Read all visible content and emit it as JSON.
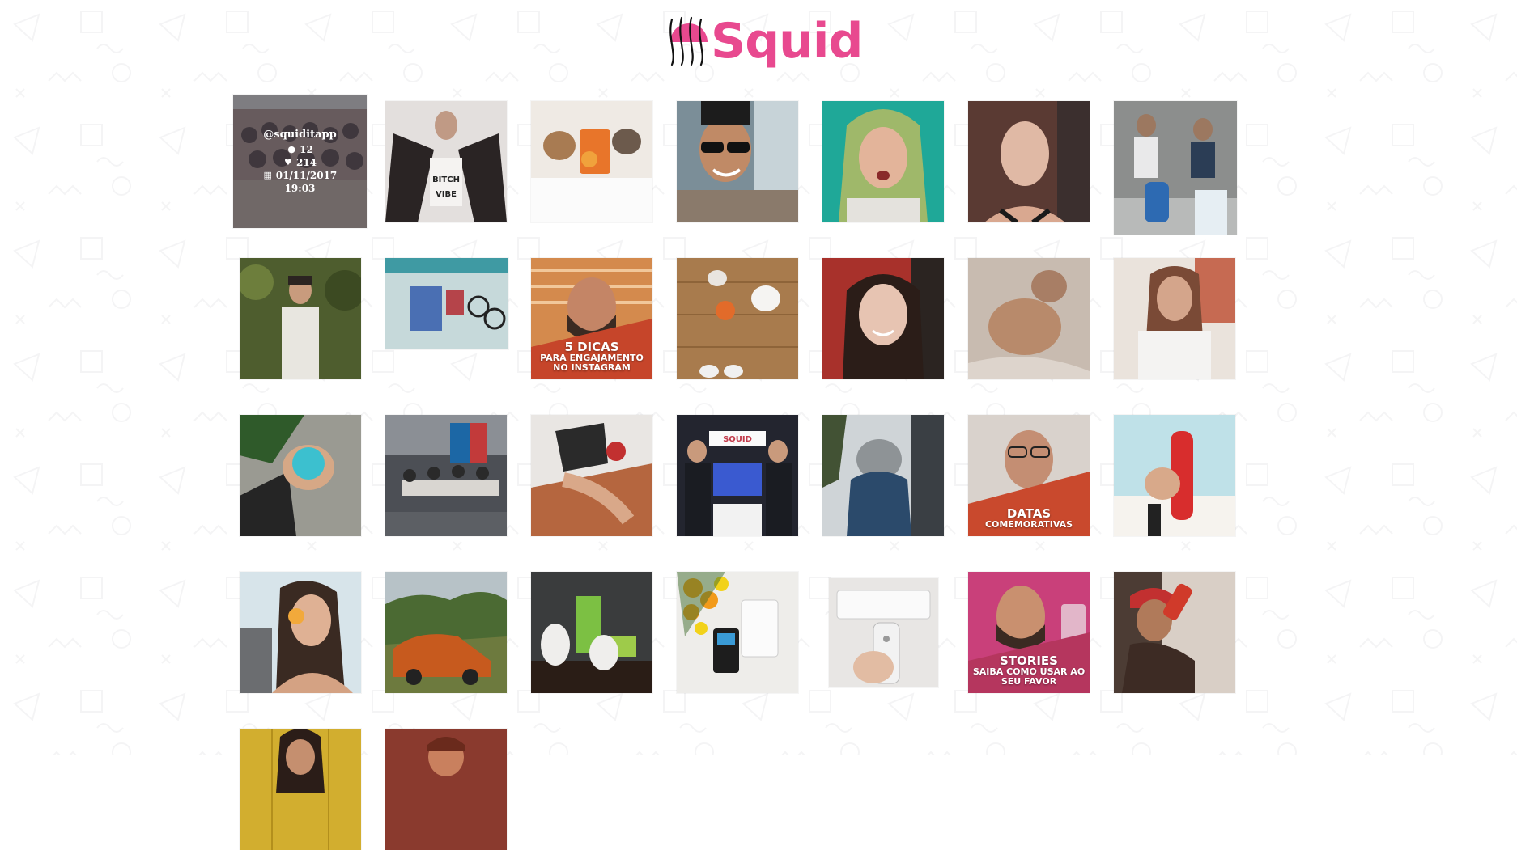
{
  "brand": {
    "name": "Squid",
    "accent": "#e8498f"
  },
  "hover_card": {
    "username": "@squiditapp",
    "comments": "12",
    "likes": "214",
    "date": "01/11/2017",
    "time": "19:03"
  },
  "tiles": [
    {
      "id": "photo-group-office",
      "tone": "#8a7f82",
      "caption": null
    },
    {
      "id": "photo-woman-bodysuit",
      "tone": "#d9d4d2",
      "caption": null
    },
    {
      "id": "photo-dogs-food",
      "tone": "#c9c1b4",
      "caption": null
    },
    {
      "id": "photo-man-sunglasses",
      "tone": "#9aa6ad",
      "caption": null
    },
    {
      "id": "photo-woman-green",
      "tone": "#3fa39a",
      "caption": null
    },
    {
      "id": "photo-woman-selfie",
      "tone": "#6b4b43",
      "caption": null
    },
    {
      "id": "photo-two-men-cleaning",
      "tone": "#8e8f8f",
      "caption": null
    },
    {
      "id": "photo-man-plants",
      "tone": "#4d5b31",
      "caption": null
    },
    {
      "id": "photo-notebook-flatlay",
      "tone": "#8fb2b6",
      "caption": null
    },
    {
      "id": "photo-man-5-dicas",
      "tone": "#b5583a",
      "caption": {
        "main": "5 DICAS",
        "sub": "PARA ENGAJAMENTO NO INSTAGRAM"
      }
    },
    {
      "id": "photo-pets-floor",
      "tone": "#a5784b",
      "caption": null
    },
    {
      "id": "photo-woman-smile",
      "tone": "#7e2d2a",
      "caption": null
    },
    {
      "id": "photo-man-bed",
      "tone": "#b9a79c",
      "caption": null
    },
    {
      "id": "photo-woman-summer",
      "tone": "#d7c9c2",
      "caption": null
    },
    {
      "id": "photo-hand-case",
      "tone": "#5d6a55",
      "caption": null
    },
    {
      "id": "photo-office-team",
      "tone": "#6e7680",
      "caption": null
    },
    {
      "id": "photo-hand-bracelets",
      "tone": "#9a5a48",
      "caption": null
    },
    {
      "id": "photo-event-booth",
      "tone": "#2b2d3a",
      "caption": null
    },
    {
      "id": "photo-child-window",
      "tone": "#6b7580",
      "caption": null
    },
    {
      "id": "photo-man-datas",
      "tone": "#c25738",
      "caption": {
        "main": "DATAS",
        "sub": "COMEMORATIVAS"
      }
    },
    {
      "id": "photo-coca-cola",
      "tone": "#c9dfe3",
      "caption": null
    },
    {
      "id": "photo-woman-beach",
      "tone": "#a38675",
      "caption": null
    },
    {
      "id": "photo-orange-car",
      "tone": "#5f6e3f",
      "caption": null
    },
    {
      "id": "photo-bulldogs",
      "tone": "#3c3e3f",
      "caption": null
    },
    {
      "id": "photo-card-machine",
      "tone": "#ecebe8",
      "caption": null
    },
    {
      "id": "photo-air-conditioner",
      "tone": "#e3e1df",
      "caption": null
    },
    {
      "id": "photo-man-stories",
      "tone": "#c2407a",
      "caption": {
        "main": "STORIES",
        "sub": "SAIBA COMO USAR AO SEU FAVOR"
      }
    },
    {
      "id": "photo-man-drinking",
      "tone": "#4c3c34",
      "caption": null
    },
    {
      "id": "photo-woman-yellow",
      "tone": "#c7a22a",
      "caption": null
    },
    {
      "id": "photo-man-red",
      "tone": "#8a3a2e",
      "caption": null
    }
  ]
}
